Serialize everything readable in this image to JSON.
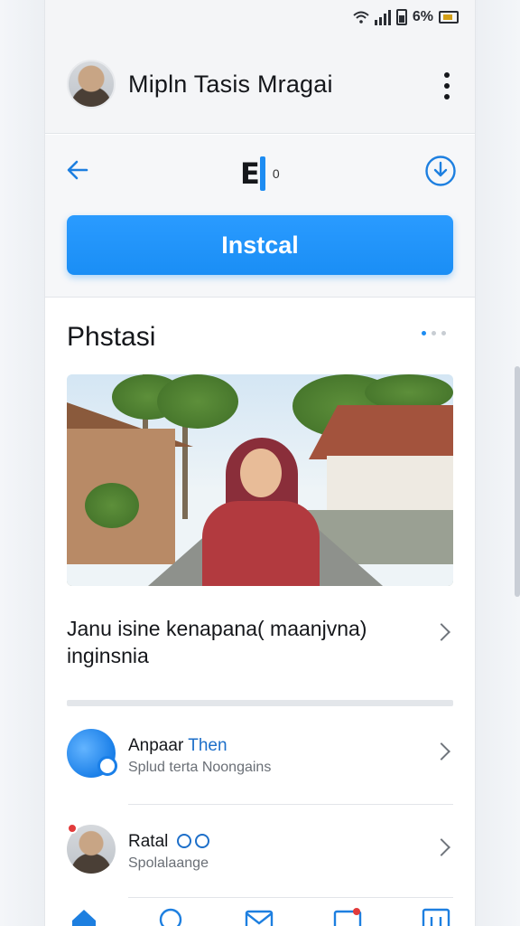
{
  "status": {
    "text": "6%"
  },
  "header": {
    "title": "Mipln Tasis  Mragai"
  },
  "toolbar": {
    "center_zero": "0",
    "install_label": "Instcal"
  },
  "section": {
    "title": "Phstasi"
  },
  "article": {
    "title": "Janu isine kenapana( maanjvna) inginsnia"
  },
  "list": [
    {
      "title": "Anpaar",
      "title_highlight": "Then",
      "subtitle": "Splud terta  Noongains"
    },
    {
      "title": "Ratal",
      "subtitle": "Spolalaange"
    }
  ],
  "colors": {
    "accent": "#1d8cf2",
    "text": "#15171b",
    "badge": "#e23b3b"
  },
  "icons": {
    "header": [
      "avatar",
      "kebab-menu-icon"
    ],
    "toolbar": [
      "back-arrow-icon",
      "download-icon"
    ],
    "tabbar": [
      "home-icon",
      "chat-icon",
      "mail-icon",
      "calendar-icon",
      "grid-icon"
    ]
  }
}
